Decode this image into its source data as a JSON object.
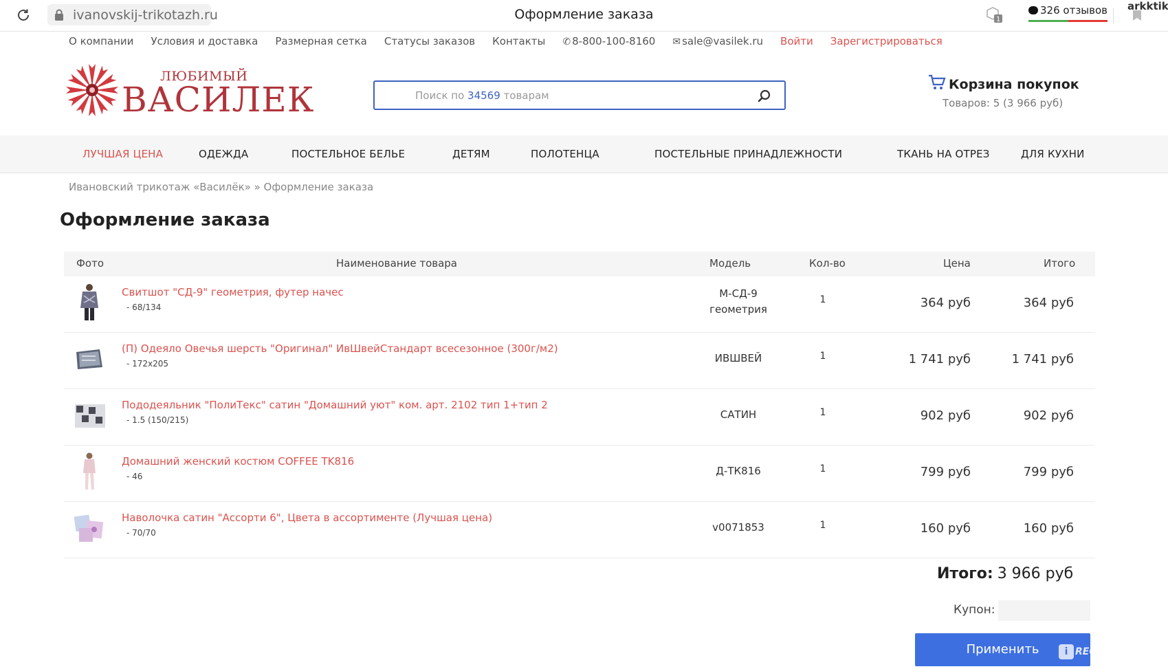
{
  "browser": {
    "url": "ivanovskij-trikotazh.ru",
    "tab_title": "Оформление заказа",
    "reviews": "326 отзывов",
    "user": "arkktika"
  },
  "topnav": {
    "about": "О компании",
    "delivery": "Условия и доставка",
    "sizes": "Размерная сетка",
    "statuses": "Статусы заказов",
    "contacts": "Контакты",
    "phone": "8-800-100-8160",
    "email": "sale@vasilek.ru",
    "login": "Войти",
    "register": "Зарегистрироваться"
  },
  "logo": {
    "small": "ЛЮБИМЫЙ",
    "big": "ВАСИЛЕК"
  },
  "search": {
    "prefix": "Поиск по ",
    "count": "34569",
    "suffix": " товарам"
  },
  "cart": {
    "title": "Корзина покупок",
    "summary": "Товаров: 5 (3 966 руб)"
  },
  "categories": [
    "ЛУЧШАЯ ЦЕНА",
    "ОДЕЖДА",
    "ПОСТЕЛЬНОЕ БЕЛЬЕ",
    "ДЕТЯМ",
    "ПОЛОТЕНЦА",
    "ПОСТЕЛЬНЫЕ ПРИНАДЛЕЖНОСТИ",
    "ТКАНЬ НА ОТРЕЗ",
    "ДЛЯ КУХНИ"
  ],
  "breadcrumb": "Ивановский трикотаж «Василёк» » Оформление заказа",
  "page_title": "Оформление заказа",
  "table": {
    "headers": {
      "photo": "Фото",
      "name": "Наименование товара",
      "model": "Модель",
      "qty": "Кол-во",
      "price": "Цена",
      "total": "Итого"
    },
    "rows": [
      {
        "name": "Свитшот \"СД-9\" геометрия, футер начес",
        "variant": "- 68/134",
        "model_line1": "М-СД-9",
        "model_line2": "геометрия",
        "qty": "1",
        "price": "364 руб",
        "total": "364 руб"
      },
      {
        "name": "(П) Одеяло Овечья шерсть \"Оригинал\" ИвШвейСтандарт всесезонное (300г/м2)",
        "variant": "- 172x205",
        "model_line1": "ИВШВЕЙ",
        "model_line2": "",
        "qty": "1",
        "price": "1 741 руб",
        "total": "1 741 руб"
      },
      {
        "name": "Пододеяльник \"ПолиТекс\" сатин \"Домашний уют\" ком. арт. 2102 тип 1+тип 2",
        "variant": "- 1.5 (150/215)",
        "model_line1": "САТИН",
        "model_line2": "",
        "qty": "1",
        "price": "902 руб",
        "total": "902 руб"
      },
      {
        "name": "Домашний женский костюм COFFEE TK816",
        "variant": "- 46",
        "model_line1": "Д-ТК816",
        "model_line2": "",
        "qty": "1",
        "price": "799 руб",
        "total": "799 руб"
      },
      {
        "name": "Наволочка сатин \"Ассорти 6\", Цвета в ассортименте (Лучшая цена)",
        "variant": "- 70/70",
        "model_line1": "v0071853",
        "model_line2": "",
        "qty": "1",
        "price": "160 руб",
        "total": "160 руб"
      }
    ]
  },
  "summary": {
    "label": "Итого:",
    "value": "3 966 руб"
  },
  "coupon": {
    "label": "Купон:",
    "value": ""
  },
  "apply_button": "Применить",
  "watermark": "RECOMMEND.RU",
  "colors": {
    "accent_red": "#d9534f",
    "brand_red": "#b0343b",
    "primary_blue": "#3d6fe0"
  }
}
